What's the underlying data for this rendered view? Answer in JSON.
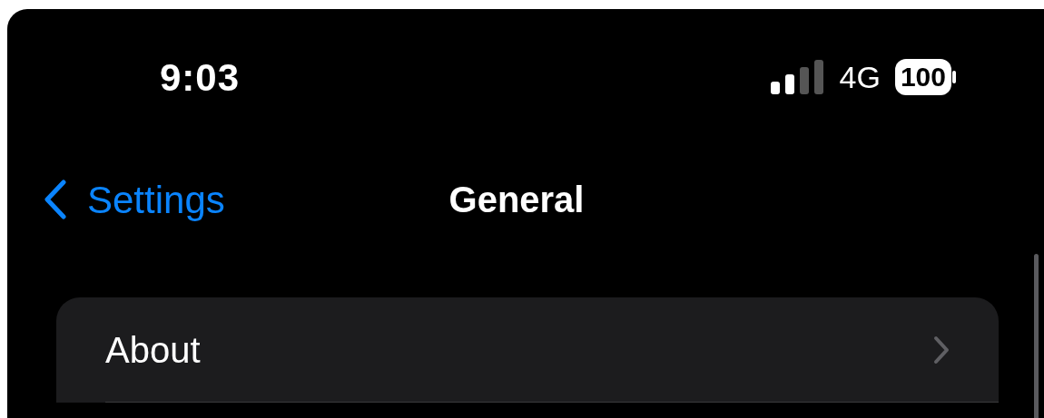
{
  "status_bar": {
    "time": "9:03",
    "network": "4G",
    "battery": "100"
  },
  "nav": {
    "back_label": "Settings",
    "title": "General"
  },
  "items": [
    {
      "label": "About"
    }
  ]
}
